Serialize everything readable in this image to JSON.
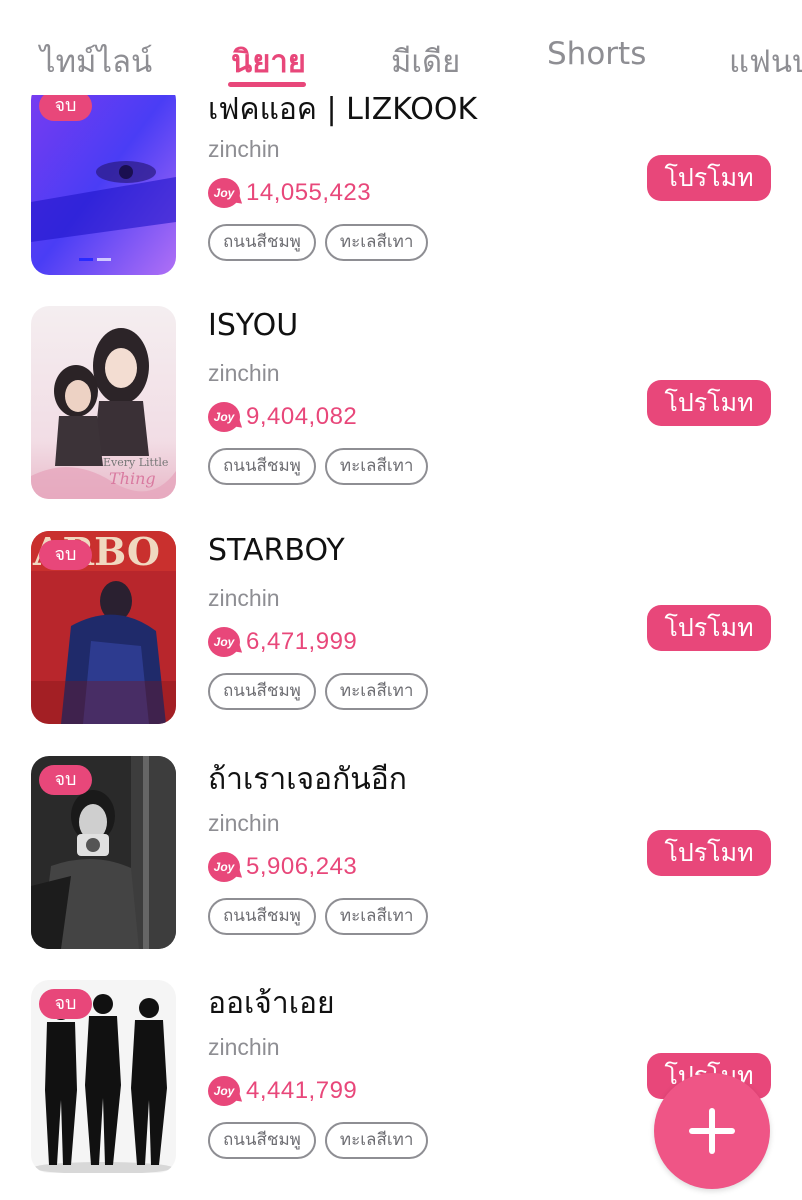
{
  "tabs": [
    {
      "label": "ไทม์ไลน์",
      "active": false
    },
    {
      "label": "นิยาย",
      "active": true
    },
    {
      "label": "มีเดีย",
      "active": false
    },
    {
      "label": "Shorts",
      "active": false
    },
    {
      "label": "แฟนบ",
      "active": false
    }
  ],
  "accent_color": "#e8477a",
  "novels": [
    {
      "title": "เฟคแอค | LIZKOOK",
      "author": "zinchin",
      "views": "14,055,423",
      "tags": [
        "ถนนสีชมพู",
        "ทะเลสีเทา"
      ],
      "done_badge": "จบ",
      "promote_label": "โปรโมท"
    },
    {
      "title": "ISYOU",
      "author": "zinchin",
      "views": "9,404,082",
      "tags": [
        "ถนนสีชมพู",
        "ทะเลสีเทา"
      ],
      "done_badge": "",
      "promote_label": "โปรโมท"
    },
    {
      "title": "STARBOY",
      "author": "zinchin",
      "views": "6,471,999",
      "tags": [
        "ถนนสีชมพู",
        "ทะเลสีเทา"
      ],
      "done_badge": "จบ",
      "promote_label": "โปรโมท"
    },
    {
      "title": "ถ้าเราเจอกันอีก",
      "author": "zinchin",
      "views": "5,906,243",
      "tags": [
        "ถนนสีชมพู",
        "ทะเลสีเทา"
      ],
      "done_badge": "จบ",
      "promote_label": "โปรโมท"
    },
    {
      "title": "ออเจ้าเอย",
      "author": "zinchin",
      "views": "4,441,799",
      "tags": [
        "ถนนสีชมพู",
        "ทะเลสีเทา"
      ],
      "done_badge": "จบ",
      "promote_label": "โปรโมท"
    }
  ],
  "joy_icon_label": "Joy",
  "fab_icon": "plus-icon"
}
